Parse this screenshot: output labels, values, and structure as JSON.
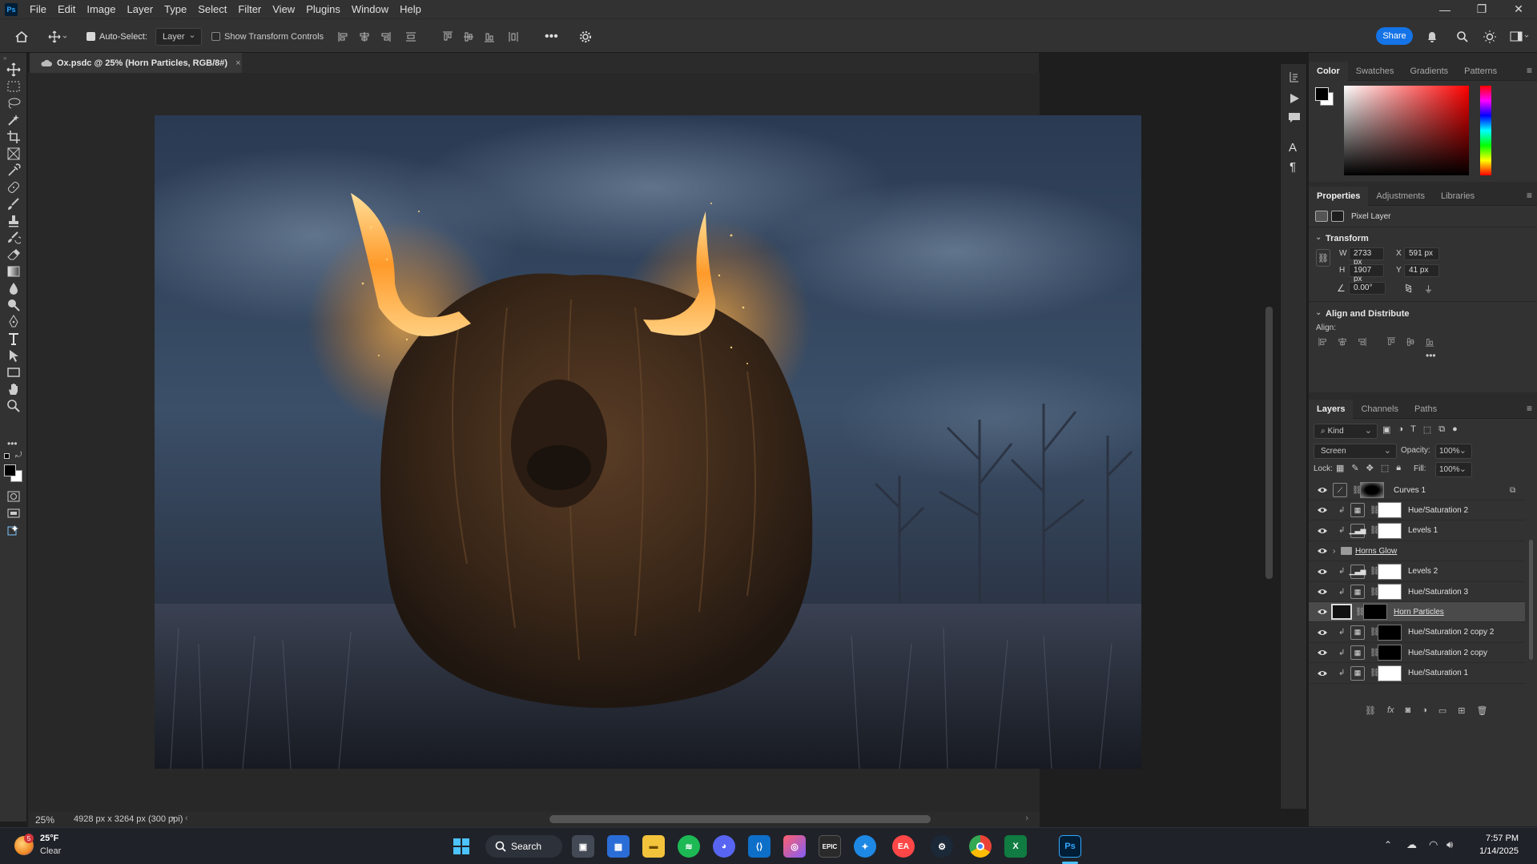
{
  "app": {
    "logo": "Ps",
    "menu": [
      "File",
      "Edit",
      "Image",
      "Layer",
      "Type",
      "Select",
      "Filter",
      "View",
      "Plugins",
      "Window",
      "Help"
    ],
    "window_controls": [
      "minimize-icon",
      "restore-icon",
      "close-icon"
    ]
  },
  "options": {
    "auto_select_label": "Auto-Select:",
    "auto_select_checked": true,
    "auto_select_value": "Layer",
    "show_transform_label": "Show Transform Controls",
    "show_transform_checked": false,
    "share_label": "Share"
  },
  "document": {
    "tab_title": "Ox.psdc @ 25% (Horn Particles, RGB/8#)",
    "zoom": "25%",
    "dimensions": "4928 px x 3264 px (300 ppi)"
  },
  "color_panel": {
    "tabs": [
      "Color",
      "Swatches",
      "Gradients",
      "Patterns"
    ],
    "active_tab": "Color",
    "foreground": "#000000",
    "background": "#ffffff",
    "hue_color": "#ff0000"
  },
  "properties": {
    "tabs": [
      "Properties",
      "Adjustments",
      "Libraries"
    ],
    "layer_type": "Pixel Layer",
    "transform_title": "Transform",
    "w_label": "W",
    "w": "2733 px",
    "h_label": "H",
    "h": "1907 px",
    "x_label": "X",
    "x": "591 px",
    "y_label": "Y",
    "y": "41 px",
    "angle": "0.00°",
    "align_title": "Align and Distribute",
    "align_label": "Align:"
  },
  "layers_panel": {
    "tabs": [
      "Layers",
      "Channels",
      "Paths"
    ],
    "filter": "Kind",
    "blend_mode": "Screen",
    "opacity_label": "Opacity:",
    "opacity": "100%",
    "lock_label": "Lock:",
    "fill_label": "Fill:",
    "fill": "100%",
    "layers": [
      {
        "name": "Curves 1",
        "type": "curves",
        "clipped": false,
        "mask": "dark",
        "selected": false
      },
      {
        "name": "Hue/Saturation 2",
        "type": "hue",
        "clipped": true,
        "mask": "white",
        "selected": false
      },
      {
        "name": "Levels 1",
        "type": "levels",
        "clipped": true,
        "mask": "white",
        "selected": false
      },
      {
        "name": "Horns Glow",
        "type": "group",
        "clipped": false,
        "mask": "none",
        "selected": false
      },
      {
        "name": "Levels 2",
        "type": "levels",
        "clipped": true,
        "mask": "white",
        "selected": false
      },
      {
        "name": "Hue/Saturation 3",
        "type": "hue",
        "clipped": true,
        "mask": "white",
        "selected": false
      },
      {
        "name": "Horn Particles",
        "type": "pixel",
        "clipped": false,
        "mask": "black",
        "selected": true
      },
      {
        "name": "Hue/Saturation 2 copy 2",
        "type": "hue",
        "clipped": true,
        "mask": "black",
        "selected": false
      },
      {
        "name": "Hue/Saturation 2 copy",
        "type": "hue",
        "clipped": true,
        "mask": "black",
        "selected": false
      },
      {
        "name": "Hue/Saturation 1",
        "type": "hue",
        "clipped": true,
        "mask": "white",
        "selected": false
      }
    ]
  },
  "taskbar": {
    "weather_temp": "25°F",
    "weather_desc": "Clear",
    "weather_badge": "5",
    "search_label": "Search",
    "time": "7:57 PM",
    "date": "1/14/2025"
  }
}
